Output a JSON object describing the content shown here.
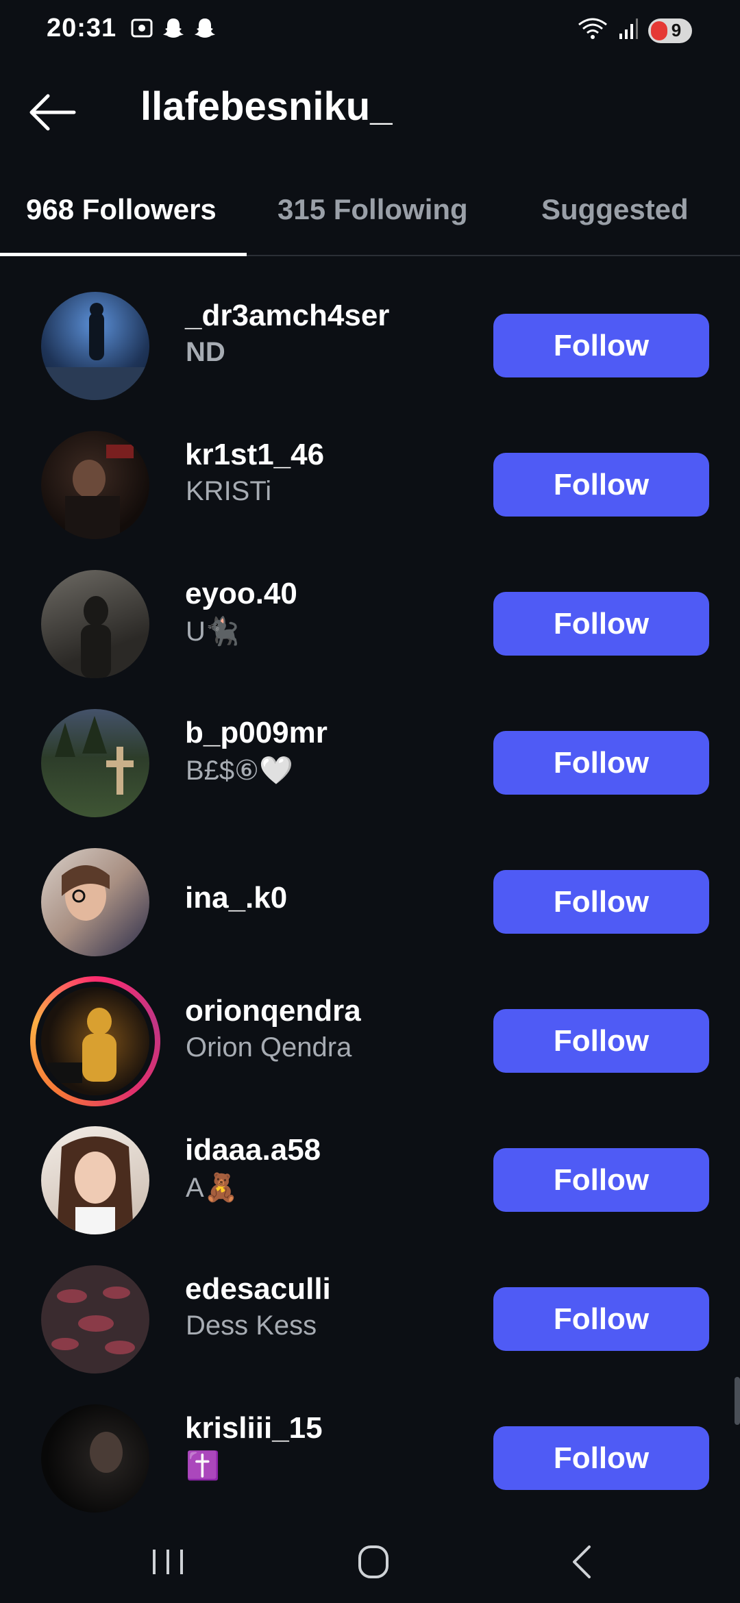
{
  "status_bar": {
    "time": "20:31",
    "battery": "9"
  },
  "header": {
    "title": "llafebesniku_"
  },
  "tabs": [
    {
      "label": "968 Followers",
      "active": true
    },
    {
      "label": "315 Following",
      "active": false
    },
    {
      "label": "Suggested",
      "active": false
    }
  ],
  "follow_label": "Follow",
  "users": [
    {
      "username": "_dr3amch4ser",
      "fullname": "ND"
    },
    {
      "username": "kr1st1_46",
      "fullname": "KRISTi"
    },
    {
      "username": "eyoo.40",
      "fullname": "U🐈‍⬛"
    },
    {
      "username": "b_p009mr",
      "fullname": "B£$⑥🤍"
    },
    {
      "username": "ina_.k0",
      "fullname": ""
    },
    {
      "username": "orionqendra",
      "fullname": "Orion Qendra"
    },
    {
      "username": "idaaa.a58",
      "fullname": "A🧸"
    },
    {
      "username": "edesaculli",
      "fullname": "Dess Kess"
    },
    {
      "username": "krisliii_15",
      "fullname": "✝️"
    }
  ],
  "colors": {
    "background": "#0c0f14",
    "button": "#4f5bf5",
    "secondary_text": "#a7acb3"
  }
}
